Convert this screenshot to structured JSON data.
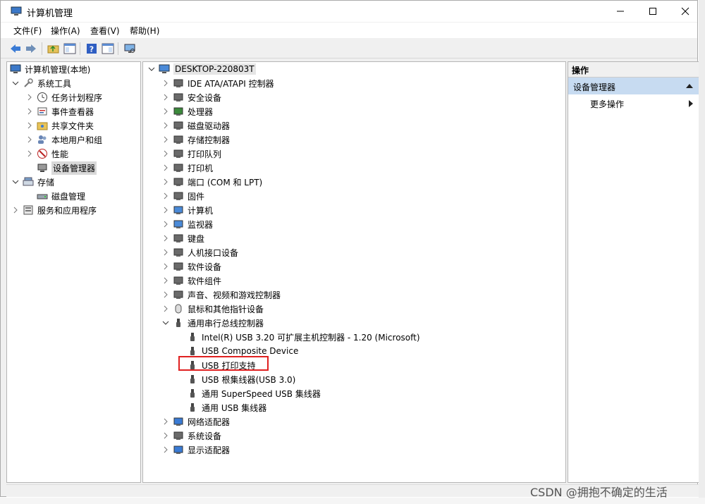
{
  "window": {
    "title": "计算机管理"
  },
  "menu": [
    "文件(F)",
    "操作(A)",
    "查看(V)",
    "帮助(H)"
  ],
  "left_tree": [
    {
      "label": "计算机管理(本地)",
      "icon": "computer-management-icon",
      "arrow": "",
      "depth": 0
    },
    {
      "label": "系统工具",
      "icon": "tools-icon",
      "arrow": "expanded",
      "depth": 1
    },
    {
      "label": "任务计划程序",
      "icon": "clock-icon",
      "arrow": "collapsed",
      "depth": 2
    },
    {
      "label": "事件查看器",
      "icon": "event-viewer-icon",
      "arrow": "collapsed",
      "depth": 2
    },
    {
      "label": "共享文件夹",
      "icon": "shared-folder-icon",
      "arrow": "collapsed",
      "depth": 2
    },
    {
      "label": "本地用户和组",
      "icon": "users-icon",
      "arrow": "collapsed",
      "depth": 2
    },
    {
      "label": "性能",
      "icon": "performance-icon",
      "arrow": "collapsed",
      "depth": 2
    },
    {
      "label": "设备管理器",
      "icon": "device-manager-icon",
      "arrow": "",
      "depth": 2,
      "selected": true
    },
    {
      "label": "存储",
      "icon": "storage-icon",
      "arrow": "expanded",
      "depth": 1
    },
    {
      "label": "磁盘管理",
      "icon": "disk-icon",
      "arrow": "",
      "depth": 2
    },
    {
      "label": "服务和应用程序",
      "icon": "services-icon",
      "arrow": "collapsed",
      "depth": 1
    }
  ],
  "device_tree": {
    "root": "DESKTOP-220803T",
    "categories": [
      {
        "label": "IDE ATA/ATAPI 控制器",
        "icon": "ide-controller-icon"
      },
      {
        "label": "安全设备",
        "icon": "security-device-icon"
      },
      {
        "label": "处理器",
        "icon": "processor-icon"
      },
      {
        "label": "磁盘驱动器",
        "icon": "disk-drive-icon"
      },
      {
        "label": "存储控制器",
        "icon": "storage-controller-icon"
      },
      {
        "label": "打印队列",
        "icon": "print-queue-icon"
      },
      {
        "label": "打印机",
        "icon": "printer-icon"
      },
      {
        "label": "端口 (COM 和 LPT)",
        "icon": "port-icon"
      },
      {
        "label": "固件",
        "icon": "firmware-icon"
      },
      {
        "label": "计算机",
        "icon": "computer-icon"
      },
      {
        "label": "监视器",
        "icon": "monitor-icon"
      },
      {
        "label": "键盘",
        "icon": "keyboard-icon"
      },
      {
        "label": "人机接口设备",
        "icon": "hid-icon"
      },
      {
        "label": "软件设备",
        "icon": "software-device-icon"
      },
      {
        "label": "软件组件",
        "icon": "software-component-icon"
      },
      {
        "label": "声音、视频和游戏控制器",
        "icon": "sound-icon"
      },
      {
        "label": "鼠标和其他指针设备",
        "icon": "mouse-icon"
      },
      {
        "label": "通用串行总线控制器",
        "icon": "usb-icon",
        "expanded": true,
        "children": [
          "Intel(R) USB 3.20 可扩展主机控制器 - 1.20 (Microsoft)",
          "USB Composite Device",
          "USB 打印支持",
          "USB 根集线器(USB 3.0)",
          "通用 SuperSpeed USB 集线器",
          "通用 USB 集线器"
        ]
      },
      {
        "label": "网络适配器",
        "icon": "network-adapter-icon"
      },
      {
        "label": "系统设备",
        "icon": "system-device-icon"
      },
      {
        "label": "显示适配器",
        "icon": "display-adapter-icon"
      }
    ]
  },
  "actions": {
    "header": "操作",
    "section": "设备管理器",
    "more": "更多操作"
  },
  "watermark": "CSDN @拥抱不确定的生活",
  "colors": {
    "selection": "#d9d9d9",
    "action_section": "#c7dbf1",
    "highlight": "#e02020"
  }
}
